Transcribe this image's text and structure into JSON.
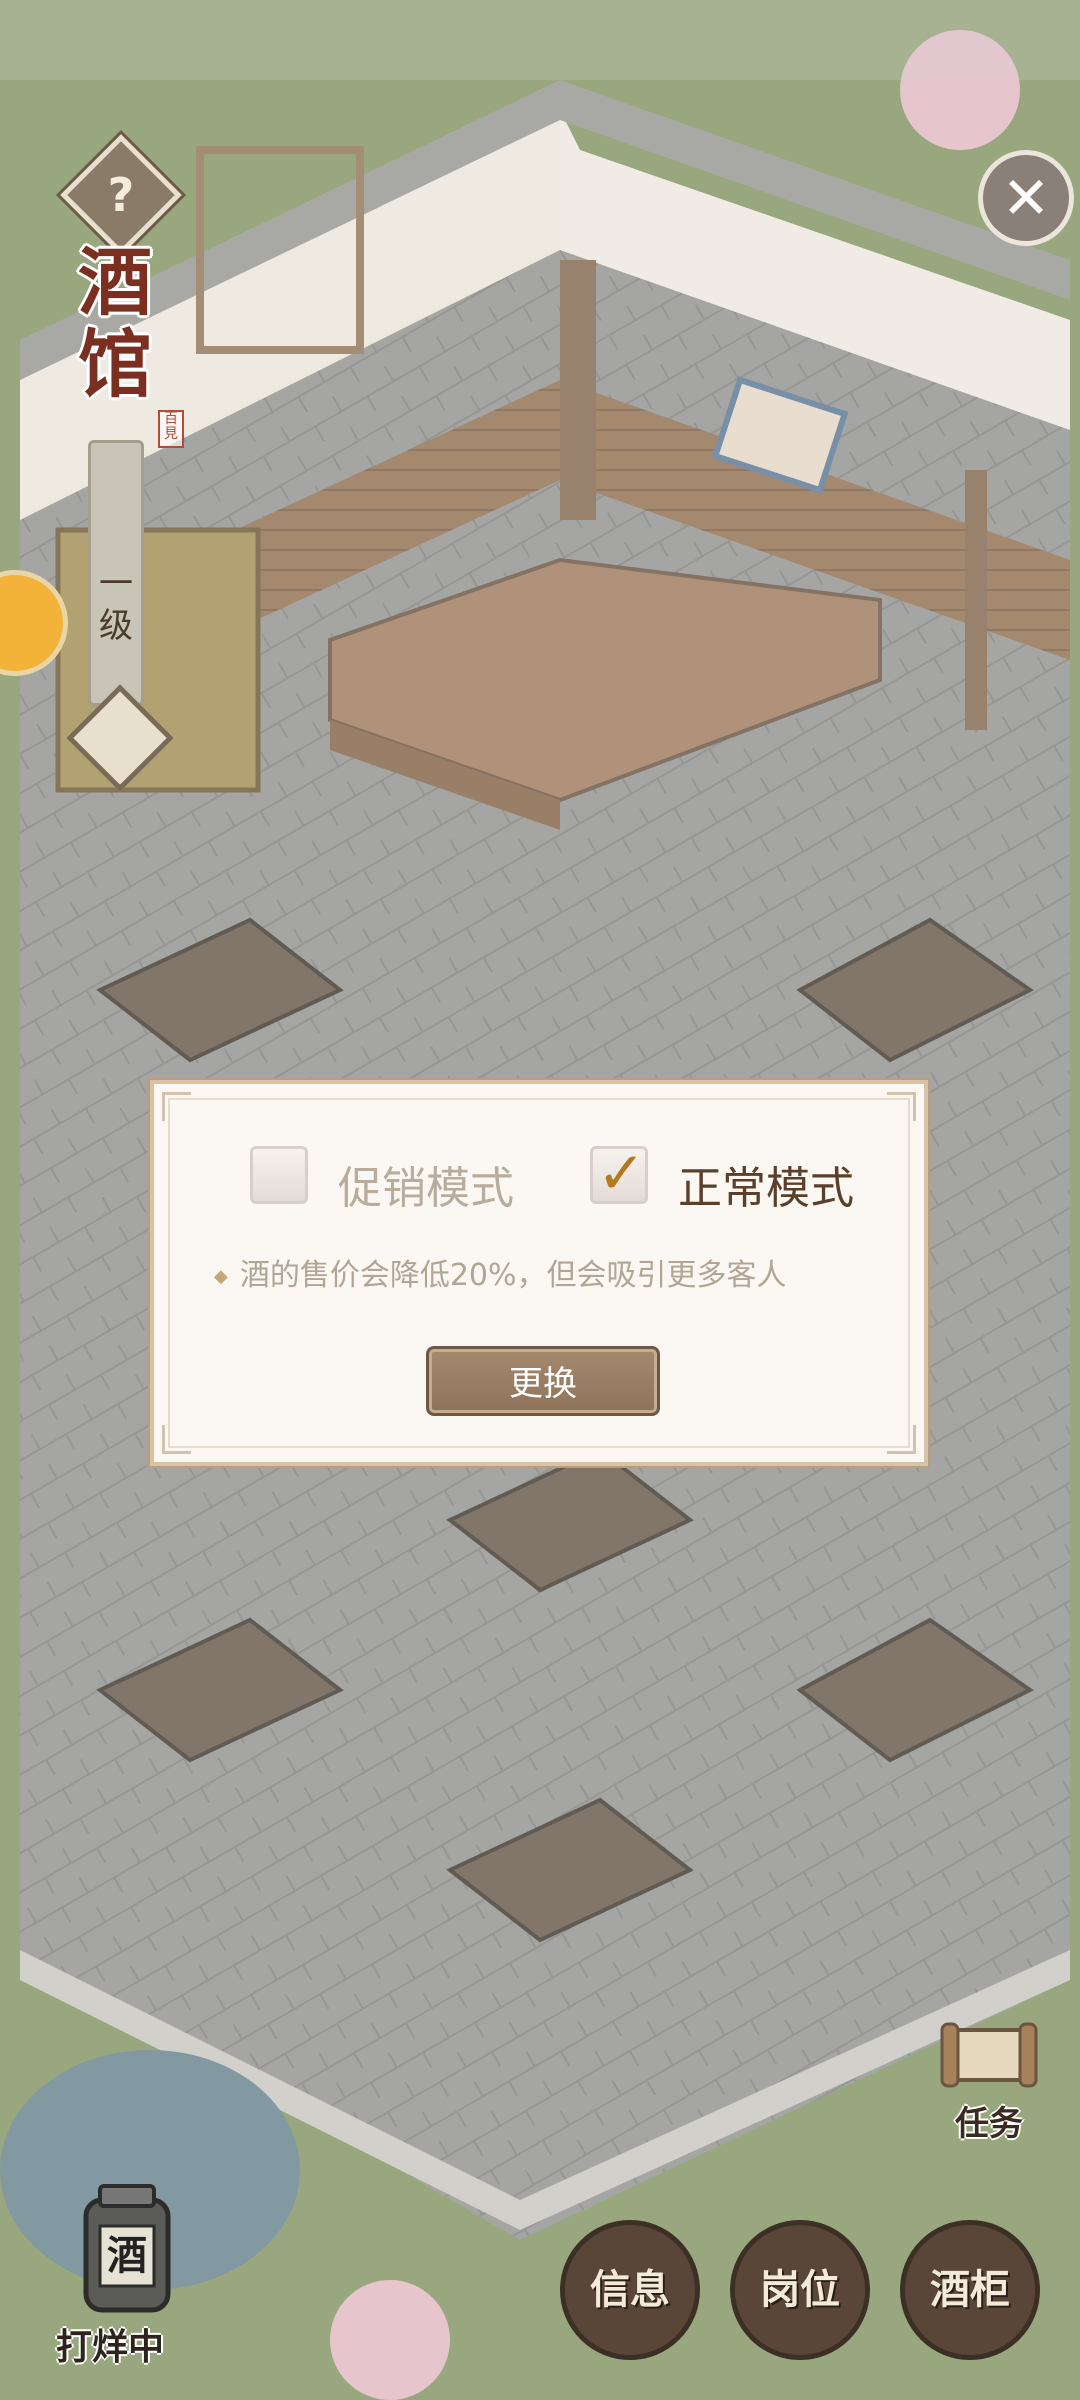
{
  "hud": {
    "help_symbol": "?",
    "venue_title": [
      "酒",
      "馆"
    ],
    "seal_text": "百見",
    "level_text": "一级",
    "close_symbol": "✕"
  },
  "dialog": {
    "promo_mode": {
      "label": "促销模式",
      "checked": false
    },
    "normal_mode": {
      "label": "正常模式",
      "checked": true
    },
    "description": "酒的售价会降低20%，但会吸引更多客人",
    "switch_label": "更换"
  },
  "bottom": {
    "task_label": "任务",
    "jar_char": "酒",
    "closing_status": "打烊中",
    "buttons": [
      "信息",
      "岗位",
      "酒柜"
    ]
  },
  "colors": {
    "accent_brown": "#8f735a",
    "title_red": "#7a2f20",
    "checkmark": "#b5781c"
  }
}
